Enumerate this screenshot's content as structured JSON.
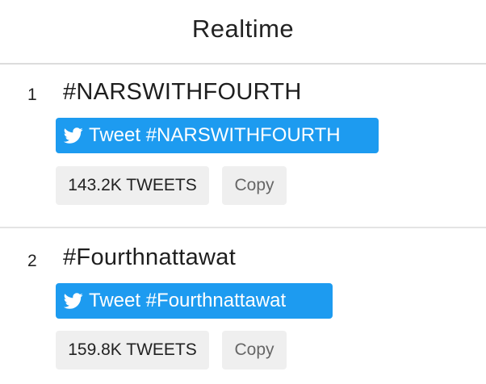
{
  "header": {
    "title": "Realtime"
  },
  "colors": {
    "tweet_button": "#1d9bf0",
    "badge_bg": "#efefef"
  },
  "trends": [
    {
      "rank": "1",
      "hashtag": "#NARSWITHFOURTH",
      "tweet_label": "Tweet #NARSWITHFOURTH",
      "count": "143.2K TWEETS",
      "copy_label": "Copy",
      "icon": "twitter-bird-icon"
    },
    {
      "rank": "2",
      "hashtag": "#Fourthnattawat",
      "tweet_label": "Tweet #Fourthnattawat",
      "count": "159.8K TWEETS",
      "copy_label": "Copy",
      "icon": "twitter-bird-icon"
    }
  ]
}
